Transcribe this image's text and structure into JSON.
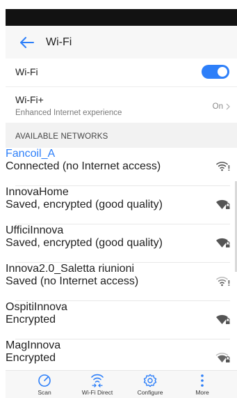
{
  "header": {
    "title": "Wi-Fi"
  },
  "wifi": {
    "label": "Wi-Fi",
    "enabled": true
  },
  "wifi_plus": {
    "label": "Wi-Fi+",
    "subtitle": "Enhanced Internet experience",
    "value": "On"
  },
  "section_title": "AVAILABLE NETWORKS",
  "networks": [
    {
      "name": "Fancoil_A",
      "status": "Connected (no Internet access)",
      "icon": "wifi-warning-icon",
      "connected": true
    },
    {
      "name": "InnovaHome",
      "status": "Saved, encrypted (good quality)",
      "icon": "wifi-lock-icon"
    },
    {
      "name": "UfficiInnova",
      "status": "Saved, encrypted (good quality)",
      "icon": "wifi-lock-icon"
    },
    {
      "name": "Innova2.0_Saletta riunioni",
      "status": "Saved (no Internet access)",
      "icon": "wifi-warning-icon"
    },
    {
      "name": "OspitiInnova",
      "status": "Encrypted",
      "icon": "wifi-lock-icon"
    },
    {
      "name": "MagInnova",
      "status": "Encrypted",
      "icon": "wifi-lock-icon"
    }
  ],
  "bottom_bar": {
    "scan": "Scan",
    "wifi_direct": "Wi-Fi Direct",
    "configure": "Configure",
    "more": "More"
  },
  "colors": {
    "accent": "#2d7ff9",
    "status_bar": "#121212"
  }
}
